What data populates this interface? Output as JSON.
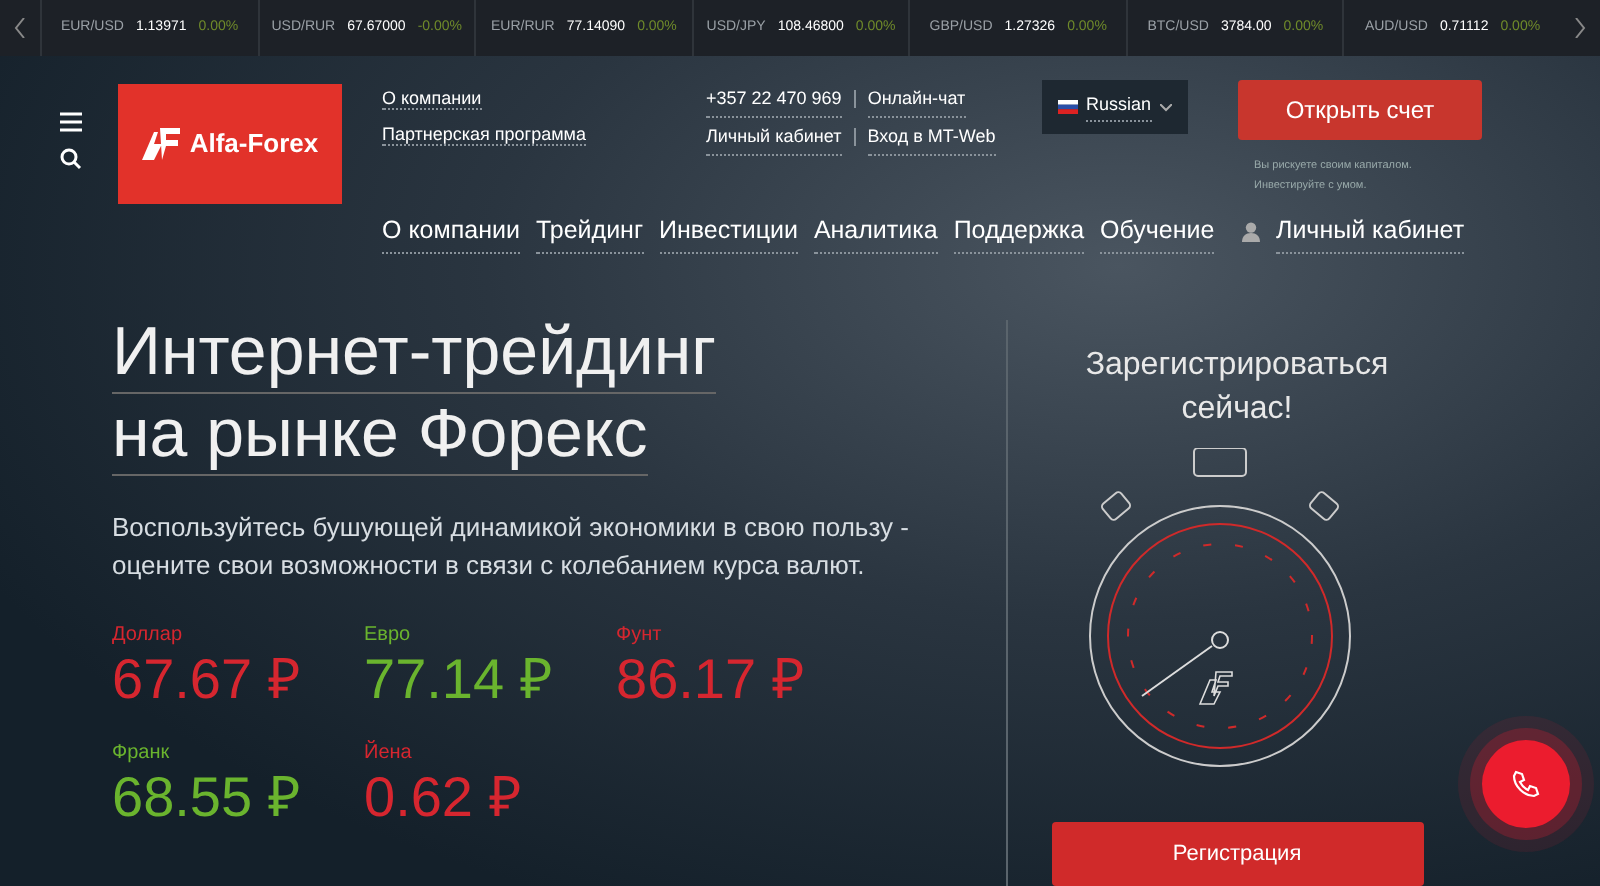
{
  "ticker": [
    {
      "pair": "EUR/USD",
      "price": "1.13971",
      "change": "0.00%"
    },
    {
      "pair": "USD/RUR",
      "price": "67.67000",
      "change": "-0.00%"
    },
    {
      "pair": "EUR/RUR",
      "price": "77.14090",
      "change": "0.00%"
    },
    {
      "pair": "USD/JPY",
      "price": "108.46800",
      "change": "0.00%"
    },
    {
      "pair": "GBP/USD",
      "price": "1.27326",
      "change": "0.00%"
    },
    {
      "pair": "BTC/USD",
      "price": "3784.00",
      "change": "0.00%"
    },
    {
      "pair": "AUD/USD",
      "price": "0.71112",
      "change": "0.00%"
    }
  ],
  "logo": {
    "text": "Alfa-Forex"
  },
  "top_links": [
    "О компании",
    "Партнерская программа"
  ],
  "contacts": [
    [
      "+357 22 470 969",
      "Онлайн-чат"
    ],
    [
      "Личный кабинет",
      "Вход в MT-Web"
    ]
  ],
  "language": {
    "label": "Russian"
  },
  "open_account": {
    "label": "Открыть счет",
    "note_lines": [
      "Вы рискуете своим капиталом.",
      "Инвестируйте с умом."
    ]
  },
  "nav": [
    "О компании",
    "Трейдинг",
    "Инвестиции",
    "Аналитика",
    "Поддержка",
    "Обучение"
  ],
  "account_link": "Личный кабинет",
  "hero": {
    "title_lines": [
      "Интернет-трейдинг",
      "на рынке Форекс"
    ],
    "subtitle": "Воспользуйтесь бушующей динамикой экономики в свою пользу - оцените свои возможности в связи с колебанием курса валют."
  },
  "rates": [
    {
      "name": "Доллар",
      "value": "67.67 ₽",
      "color": "#d6262f"
    },
    {
      "name": "Евро",
      "value": "77.14 ₽",
      "color": "#6ab42e"
    },
    {
      "name": "Фунт",
      "value": "86.17 ₽",
      "color": "#d6262f"
    },
    {
      "name": "Франк",
      "value": "68.55 ₽",
      "color": "#6ab42e"
    },
    {
      "name": "Йена",
      "value": "0.62 ₽",
      "color": "#d6262f"
    }
  ],
  "register": {
    "title": "Зарегистрироваться сейчас!",
    "button": "Регистрация"
  }
}
